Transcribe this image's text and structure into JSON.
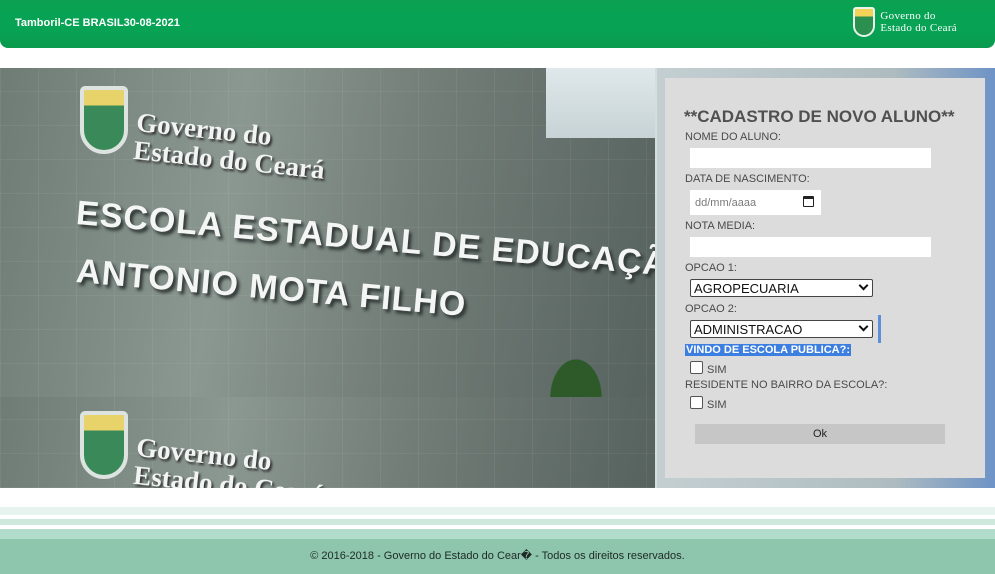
{
  "header": {
    "location_date": "Tamboril-CE BRASIL30-08-2021",
    "gov_logo_line1": "Governo do",
    "gov_logo_line2": "Estado do Ceará"
  },
  "hero": {
    "carved_gov_line1": "Governo do",
    "carved_gov_line2": "Estado do Ceará",
    "school_line1": "ESCOLA ESTADUAL DE EDUCAÇÃO PROFISSIONAL",
    "school_line2": "ANTONIO MOTA FILHO"
  },
  "form": {
    "title": "**CADASTRO DE NOVO ALUNO**",
    "name_label": "NOME DO ALUNO:",
    "name_value": "",
    "birth_label": "DATA DE NASCIMENTO:",
    "birth_placeholder": "dd/mm/aaaa",
    "grade_label": "NOTA MEDIA:",
    "grade_value": "",
    "option1_label": "OPCAO 1:",
    "option1_value": "AGROPECUARIA",
    "option2_label": "OPCAO 2:",
    "option2_value": "ADMINISTRACAO",
    "public_school_label": "VINDO DE ESCOLA PUBLICA?:",
    "public_school_option": "SIM",
    "public_school_checked": false,
    "resident_label": "RESIDENTE NO BAIRRO DA ESCOLA?:",
    "resident_option": "SIM",
    "resident_checked": false,
    "ok_label": "Ok"
  },
  "footer": {
    "copyright": "© 2016-2018 - Governo do Estado do Cear� - Todos os direitos reservados."
  },
  "colors": {
    "header_green": "#07a355",
    "footer_green": "#8ec5ad",
    "form_panel": "#dcdcdc",
    "highlight_blue": "#3c7fe0"
  },
  "icons": [
    "state-seal-icon",
    "calendar-icon",
    "chevron-down-icon"
  ]
}
